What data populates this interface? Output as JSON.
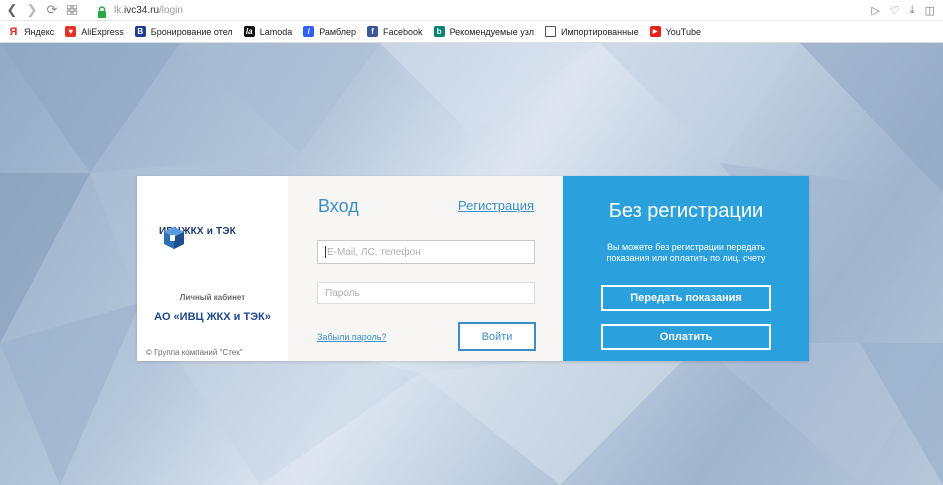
{
  "browser": {
    "url_prefix": "lk.",
    "url_domain": "ivc34.ru",
    "url_path": "/login",
    "bookmarks": [
      {
        "label": "Яндекс",
        "icon": "yandex-icon",
        "color": "#e52620"
      },
      {
        "label": "AliExpress",
        "icon": "aliexpress-icon",
        "color": "#e43225"
      },
      {
        "label": "Бронирование отел",
        "icon": "booking-icon",
        "color": "#1c3f94"
      },
      {
        "label": "Lamoda",
        "icon": "lamoda-icon",
        "color": "#111111"
      },
      {
        "label": "Рамблер",
        "icon": "rambler-icon",
        "color": "#315efb"
      },
      {
        "label": "Facebook",
        "icon": "facebook-icon",
        "color": "#3b5998"
      },
      {
        "label": "Рекомендуемые узл",
        "icon": "bing-icon",
        "color": "#008373"
      },
      {
        "label": "Импортированные",
        "icon": "folder-icon",
        "color": "#555555"
      },
      {
        "label": "YouTube",
        "icon": "youtube-icon",
        "color": "#e62117"
      }
    ]
  },
  "brand": {
    "logo_left": "ИВЦ",
    "logo_right": "ЖКХ и ТЭК",
    "cabinet_label": "Личный кабинет",
    "org_name": "АО «ИВЦ ЖКХ и ТЭК»",
    "copyright": "© Группа компаний \"Стек\""
  },
  "login": {
    "title": "Вход",
    "register_link": "Регистрация",
    "email_placeholder": "E-Mail, ЛС, телефон",
    "password_placeholder": "Пароль",
    "forgot_link": "Забыли пароль?",
    "submit_label": "Войти"
  },
  "no_registration": {
    "title": "Без регистрации",
    "description": "Вы можете без регистрации передать показания или оплатить по лиц. счету",
    "send_readings_label": "Передать показания",
    "pay_label": "Оплатить"
  },
  "colors": {
    "accent": "#3a8fc8",
    "panel_blue": "#2aa0dc",
    "brand_navy": "#1f3a73"
  }
}
